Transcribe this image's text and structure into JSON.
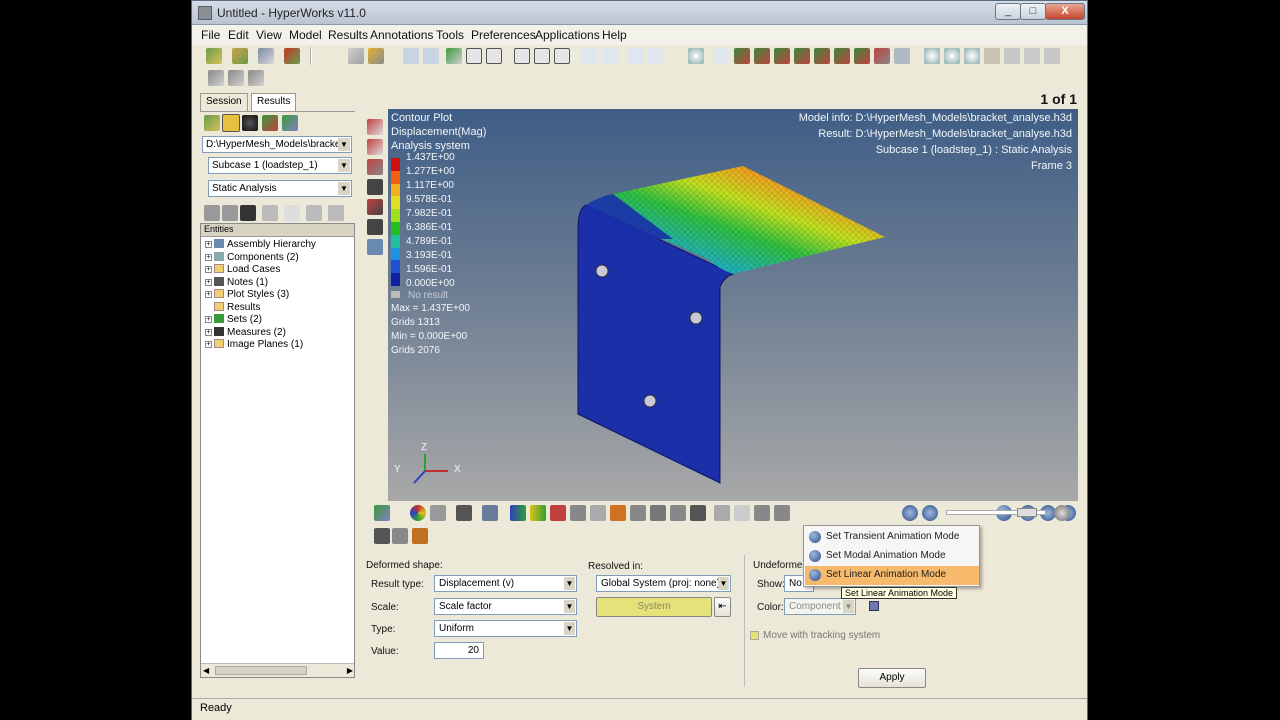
{
  "window": {
    "title": "Untitled - HyperWorks v11.0",
    "controls": [
      "_",
      "□",
      "X"
    ]
  },
  "menu": [
    "File",
    "Edit",
    "View",
    "Model",
    "Results",
    "Annotations",
    "Tools",
    "Preferences",
    "Applications",
    "Help"
  ],
  "left_panel": {
    "tabs": [
      "Session",
      "Results"
    ],
    "file_select": "D:\\HyperMesh_Models\\bracket",
    "subcase_select": "Subcase 1 (loadstep_1)",
    "analysis_select": "Static Analysis",
    "entities_header": "Entities",
    "tree": [
      "Assembly Hierarchy",
      "Components (2)",
      "Load Cases",
      "Notes (1)",
      "Plot Styles (3)",
      "Results",
      "Sets (2)",
      "Measures (2)",
      "Image Planes (1)"
    ]
  },
  "viewport": {
    "page_count": "1 of 1",
    "contour_title": "Contour Plot",
    "contour_sub1": "Displacement(Mag)",
    "contour_sub2": "Analysis system",
    "legend": [
      "1.437E+00",
      "1.277E+00",
      "1.117E+00",
      "9.578E-01",
      "7.982E-01",
      "6.386E-01",
      "4.789E-01",
      "3.193E-01",
      "1.596E-01",
      "0.000E+00"
    ],
    "legend_colors": [
      "#d01010",
      "#f06010",
      "#f0b020",
      "#e0e020",
      "#a0e020",
      "#20c020",
      "#20c0a0",
      "#2090e0",
      "#2050d0",
      "#1020a0"
    ],
    "no_result": "No result",
    "max": "Max = 1.437E+00",
    "max_grids": "Grids 1313",
    "min": "Min = 0.000E+00",
    "min_grids": "Grids 2076",
    "model_info": "Model info: D:\\HyperMesh_Models\\bracket_analyse.h3d",
    "result": "Result: D:\\HyperMesh_Models\\bracket_analyse.h3d",
    "subcase": "Subcase 1 (loadstep_1) : Static Analysis",
    "frame": "Frame 3",
    "axes": {
      "x": "X",
      "y": "Y",
      "z": "Z"
    }
  },
  "panel": {
    "deformed_shape": "Deformed shape:",
    "result_type_label": "Result type:",
    "result_type_value": "Displacement (v)",
    "scale_label": "Scale:",
    "scale_value": "Scale factor",
    "type_label": "Type:",
    "type_value": "Uniform",
    "value_label": "Value:",
    "value_value": "20",
    "resolved_in": "Resolved in:",
    "resolved_value": "Global System (proj: none)",
    "system_btn": "System",
    "undeformed": "Undeformed",
    "show_label": "Show:",
    "show_value": "No",
    "color_label": "Color:",
    "color_value": "Component",
    "track_label": "Move with tracking system",
    "apply": "Apply"
  },
  "anim_menu": {
    "items": [
      "Set Transient Animation Mode",
      "Set Modal Animation Mode",
      "Set Linear Animation Mode"
    ],
    "highlighted_index": 2,
    "tooltip": "Set Linear Animation Mode"
  },
  "status": "Ready"
}
